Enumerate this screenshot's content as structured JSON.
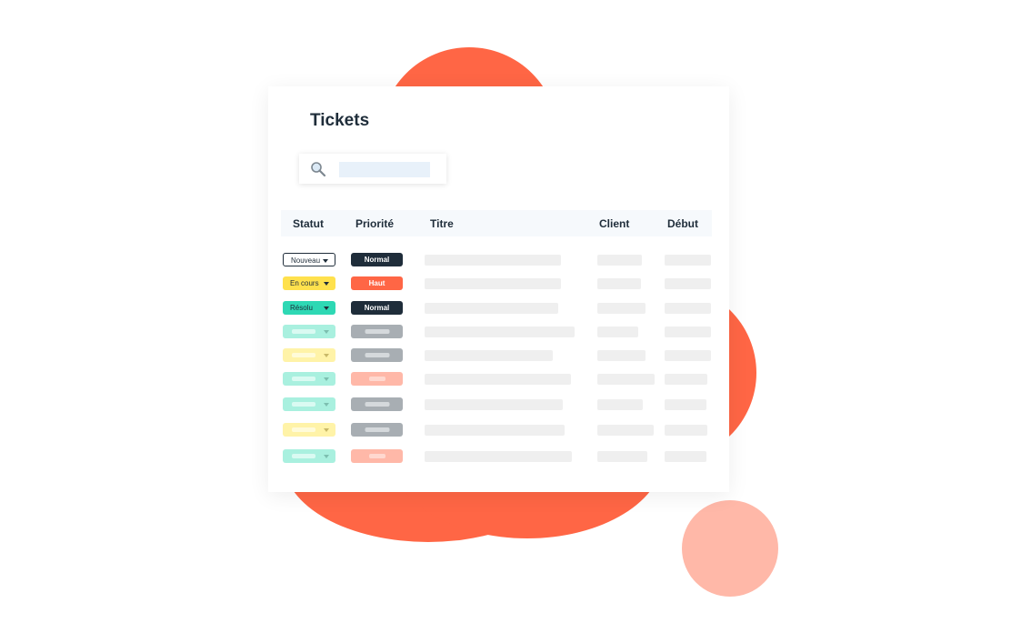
{
  "page": {
    "title": "Tickets",
    "colors": {
      "accent": "#ff6645",
      "accent_light": "#ffb8a8",
      "dark": "#1f2d3a"
    }
  },
  "search": {
    "icon": "search-icon",
    "value": ""
  },
  "table": {
    "columns": [
      "Statut",
      "Priorité",
      "Titre",
      "Client",
      "Début"
    ],
    "rows": [
      {
        "status": "Nouveau",
        "status_style": "outline",
        "priority": "Normal",
        "priority_style": "dark"
      },
      {
        "status": "En cours",
        "status_style": "yellow",
        "priority": "Haut",
        "priority_style": "orange"
      },
      {
        "status": "Résolu",
        "status_style": "teal",
        "priority": "Normal",
        "priority_style": "dark"
      },
      {
        "status_style": "teal-faded",
        "priority_style": "gray"
      },
      {
        "status_style": "yellow-faded",
        "priority_style": "gray"
      },
      {
        "status_style": "teal-faded",
        "priority_style": "salmon"
      },
      {
        "status_style": "teal-faded",
        "priority_style": "gray"
      },
      {
        "status_style": "yellow-faded",
        "priority_style": "gray"
      },
      {
        "status_style": "teal-faded",
        "priority_style": "salmon"
      }
    ]
  }
}
